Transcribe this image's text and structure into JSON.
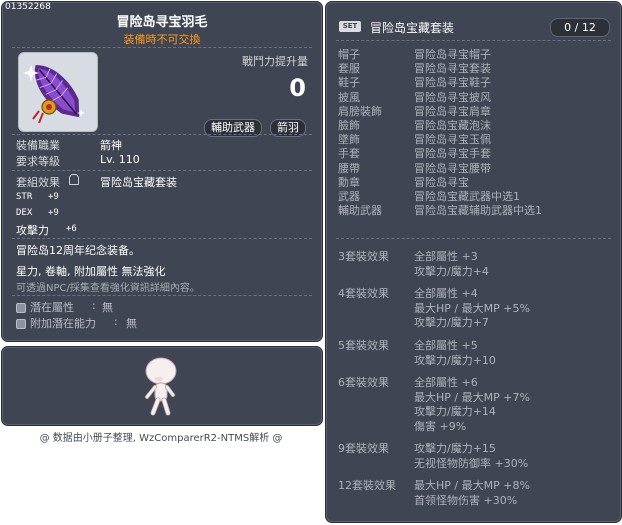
{
  "item": {
    "id": "01352268",
    "name": "冒险岛寻宝羽毛",
    "untradable": "装備時不可交換",
    "power_label": "戰鬥力提升量",
    "power_value": "0",
    "category_primary": "輔助武器",
    "category_secondary": "箭羽",
    "req_job_label": "裝備職業",
    "req_job_value": "箭神",
    "req_level_label": "要求等級",
    "req_level_value": "Lv. 110",
    "set_effect_label": "套組效果",
    "set_effect_value": "冒险岛宝藏套装",
    "stats": [
      {
        "name": "STR",
        "value": "+9"
      },
      {
        "name": "DEX",
        "value": "+9"
      },
      {
        "name": "攻擊力",
        "value": "+6"
      }
    ],
    "desc_line1": "冒险岛12周年纪念装备。",
    "desc_line2": "星力, 卷軸, 附加屬性 無法強化",
    "desc_line3": "可透過NPC/採集查看強化資訊詳細內容。",
    "potential_label": "潛在屬性",
    "potential_value": "無",
    "bonus_potential_label": "附加潛在能力",
    "bonus_potential_value": "無",
    "icon_name": "feather-icon"
  },
  "credit": "@ 数据由小册子整理, WzComparerR2-NTMS解析 @",
  "set": {
    "tag": "SET",
    "title": "冒险岛宝藏套装",
    "count": "0 / 12",
    "parts": [
      {
        "slot": "帽子",
        "name": "冒险岛寻宝帽子"
      },
      {
        "slot": "套服",
        "name": "冒险岛寻宝套装"
      },
      {
        "slot": "鞋子",
        "name": "冒险岛寻宝鞋子"
      },
      {
        "slot": "披風",
        "name": "冒险岛寻宝披风"
      },
      {
        "slot": "肩膀裝飾",
        "name": "冒险岛寻宝肩章"
      },
      {
        "slot": "臉飾",
        "name": "冒险岛宝藏泡沫"
      },
      {
        "slot": "墜飾",
        "name": "冒险岛寻宝玉佩"
      },
      {
        "slot": "手套",
        "name": "冒险岛寻宝手套"
      },
      {
        "slot": "腰帶",
        "name": "冒险岛寻宝腰带"
      },
      {
        "slot": "勳章",
        "name": "冒险岛寻宝"
      },
      {
        "slot": "武器",
        "name": "冒险岛宝藏武器中选1"
      },
      {
        "slot": "輔助武器",
        "name": "冒险岛宝藏辅助武器中选1"
      }
    ],
    "effects": [
      {
        "head": "3套裝效果",
        "lines": [
          "全部屬性 +3",
          "攻擊力/魔力+4"
        ]
      },
      {
        "head": "4套裝效果",
        "lines": [
          "全部屬性 +4",
          "最大HP / 最大MP  +5%",
          "攻擊力/魔力+7"
        ]
      },
      {
        "head": "5套裝效果",
        "lines": [
          "全部屬性 +5",
          "攻擊力/魔力+10"
        ]
      },
      {
        "head": "6套裝效果",
        "lines": [
          "全部屬性 +6",
          "最大HP / 最大MP  +7%",
          "攻擊力/魔力+14",
          "傷害 +9%"
        ]
      },
      {
        "head": "9套裝效果",
        "lines": [
          "攻擊力/魔力+15",
          "无视怪物防御率 +30%"
        ]
      },
      {
        "head": "12套裝效果",
        "lines": [
          "最大HP / 最大MP  +8%",
          "首领怪物伤害 +30%"
        ]
      }
    ]
  }
}
